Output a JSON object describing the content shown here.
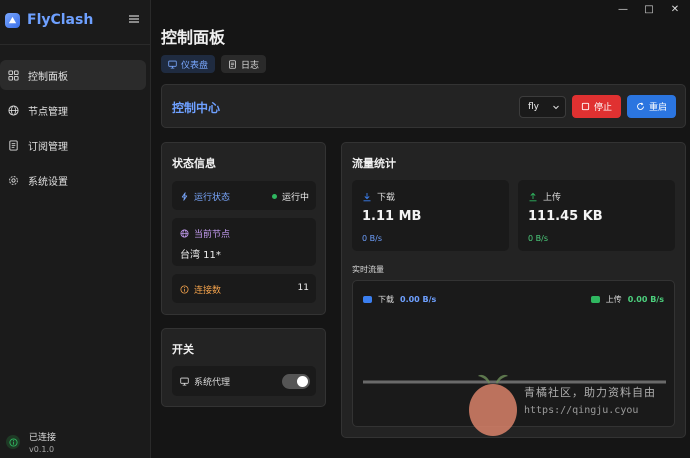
{
  "app": {
    "name": "FlyClash",
    "accent": "#6ea0ff"
  },
  "window_controls": [
    "—",
    "□",
    "✕"
  ],
  "sidebar": {
    "items": [
      {
        "label": "控制面板",
        "icon": "dashboard-icon",
        "active": true
      },
      {
        "label": "节点管理",
        "icon": "globe-icon",
        "active": false
      },
      {
        "label": "订阅管理",
        "icon": "document-icon",
        "active": false
      },
      {
        "label": "系统设置",
        "icon": "gear-icon",
        "active": false
      }
    ],
    "connection": {
      "status": "已连接",
      "version": "v0.1.0"
    }
  },
  "page": {
    "title": "控制面板",
    "tabs": [
      {
        "label": "仪表盘",
        "icon": "monitor-icon",
        "active": true
      },
      {
        "label": "日志",
        "icon": "file-icon",
        "active": false
      }
    ]
  },
  "control_center": {
    "title": "控制中心",
    "profile_selected": "fly",
    "stop_label": "停止",
    "restart_label": "重启",
    "stop_color": "#e03131",
    "restart_color": "#2b75e0"
  },
  "status_info": {
    "title": "状态信息",
    "run_state_label": "运行状态",
    "run_state_value": "运行中",
    "current_node_label": "当前节点",
    "current_node_value": "台湾 11*",
    "connections_label": "连接数",
    "connections_value": "11",
    "run_color": "#7aa8ff",
    "node_color": "#c49cf2",
    "conn_color": "#f0a04b"
  },
  "switches": {
    "title": "开关",
    "system_proxy_label": "系统代理",
    "system_proxy_on": true
  },
  "traffic": {
    "title": "流量统计",
    "download_label": "下载",
    "download_total": "1.11 MB",
    "download_rate": "0 B/s",
    "upload_label": "上传",
    "upload_total": "111.45 KB",
    "upload_rate": "0 B/s",
    "realtime_label": "实时流量",
    "legend_download_label": "下载",
    "legend_download_value": "0.00 B/s",
    "legend_upload_label": "上传",
    "legend_upload_value": "0.00 B/s",
    "download_color": "#3b7ff0",
    "upload_color": "#2fb760"
  },
  "watermark": {
    "line1": "青橘社区，助力资料自由",
    "line2": "https://qingju.cyou"
  }
}
